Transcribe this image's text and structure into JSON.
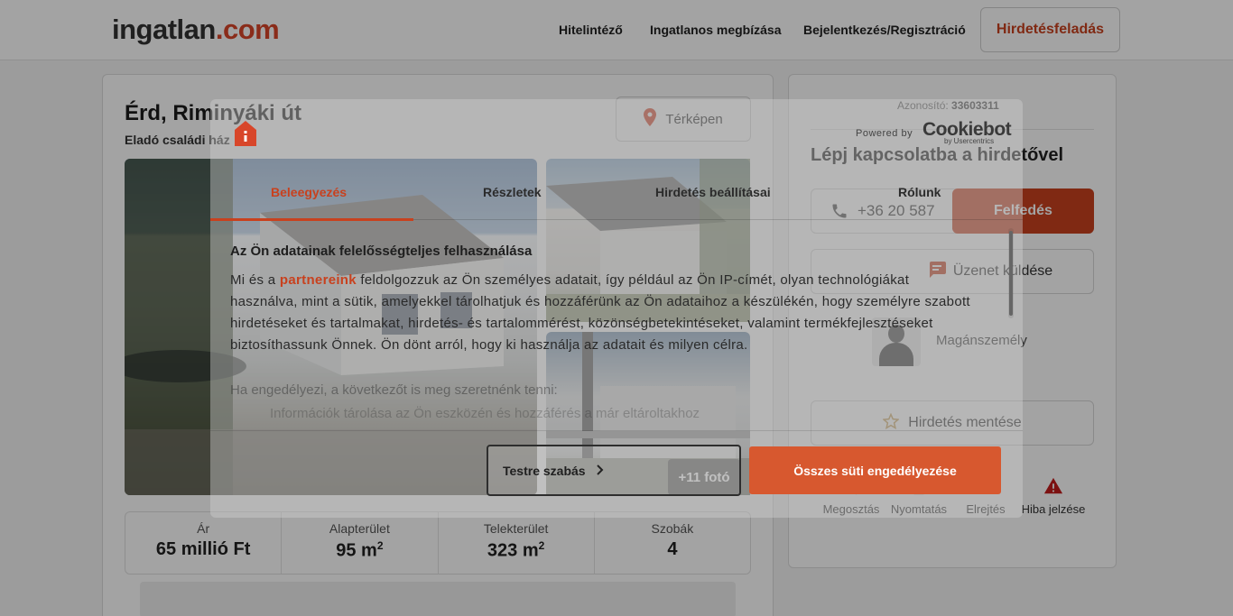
{
  "header": {
    "logo_main": "ingatlan",
    "logo_dot": ".",
    "logo_tld": "com",
    "nav": [
      "Hitelintéző",
      "Ingatlanos megbízása",
      "Bejelentkezés/Regisztráció"
    ],
    "post_button": "Hirdetésfeladás"
  },
  "listing": {
    "title": "Érd, Riminyáki út",
    "subtitle": "Eladó családi ház",
    "map_button": "Térképen",
    "more_photos": "+11 fotó",
    "stats": [
      {
        "label": "Ár",
        "value": "65 millió Ft",
        "sup": ""
      },
      {
        "label": "Alapterület",
        "value": "95 m",
        "sup": "2"
      },
      {
        "label": "Telekterület",
        "value": "323 m",
        "sup": "2"
      },
      {
        "label": "Szobák",
        "value": "4",
        "sup": ""
      }
    ]
  },
  "sidebar": {
    "ad_id_label": "Azonosító:",
    "ad_id": "33603311",
    "contact_title": "Lépj kapcsolatba a hirdetővel",
    "phone": "+36 20 587",
    "reveal_button": "Felfedés",
    "message_button": "Üzenet küldése",
    "owner_type": "Magánszemély",
    "save_button": "Hirdetés mentése",
    "actions": [
      {
        "label": "Megosztás",
        "icon": "share-icon"
      },
      {
        "label": "Nyomtatás",
        "icon": "print-icon"
      },
      {
        "label": "Elrejtés",
        "icon": "hide-icon"
      },
      {
        "label": "Hiba jelzése",
        "icon": "warning-icon"
      }
    ]
  },
  "cookie_dialog": {
    "powered_by": "Powered by",
    "brand": "Cookiebot",
    "brand_sub": "by Usercentrics",
    "tabs": [
      "Beleegyezés",
      "Részletek",
      "Hirdetés beállításai",
      "Rólunk"
    ],
    "active_tab": 0,
    "heading": "Az Ön adatainak felelősségteljes felhasználása",
    "body_before": "Mi és a ",
    "partners_link": "partnereink",
    "body_after": " feldolgozzuk az Ön személyes adatait, így például az Ön IP-címét, olyan technológiákat használva, mint a sütik, amelyekkel tárolhatjuk és hozzáférünk az Ön adataihoz a készülékén, hogy személyre szabott hirdetéseket és tartalmakat, hirdetés- és tartalommérést, közönségbetekintéseket, valamint termékfejlesztéseket biztosíthassunk Önnek. Ön dönt arról, hogy ki használja az adatait és milyen célra.",
    "faded_line": "Ha engedélyezi, a következőt is meg szeretnénk tenni:",
    "faded_line2": "Információk tárolása az Ön eszközén és hozzáférés a már eltároltakhoz",
    "customize_button": "Testre szabás",
    "accept_button": "Összes süti engedélyezése"
  },
  "colors": {
    "brand": "#c8411e",
    "accept": "#d7582f"
  }
}
